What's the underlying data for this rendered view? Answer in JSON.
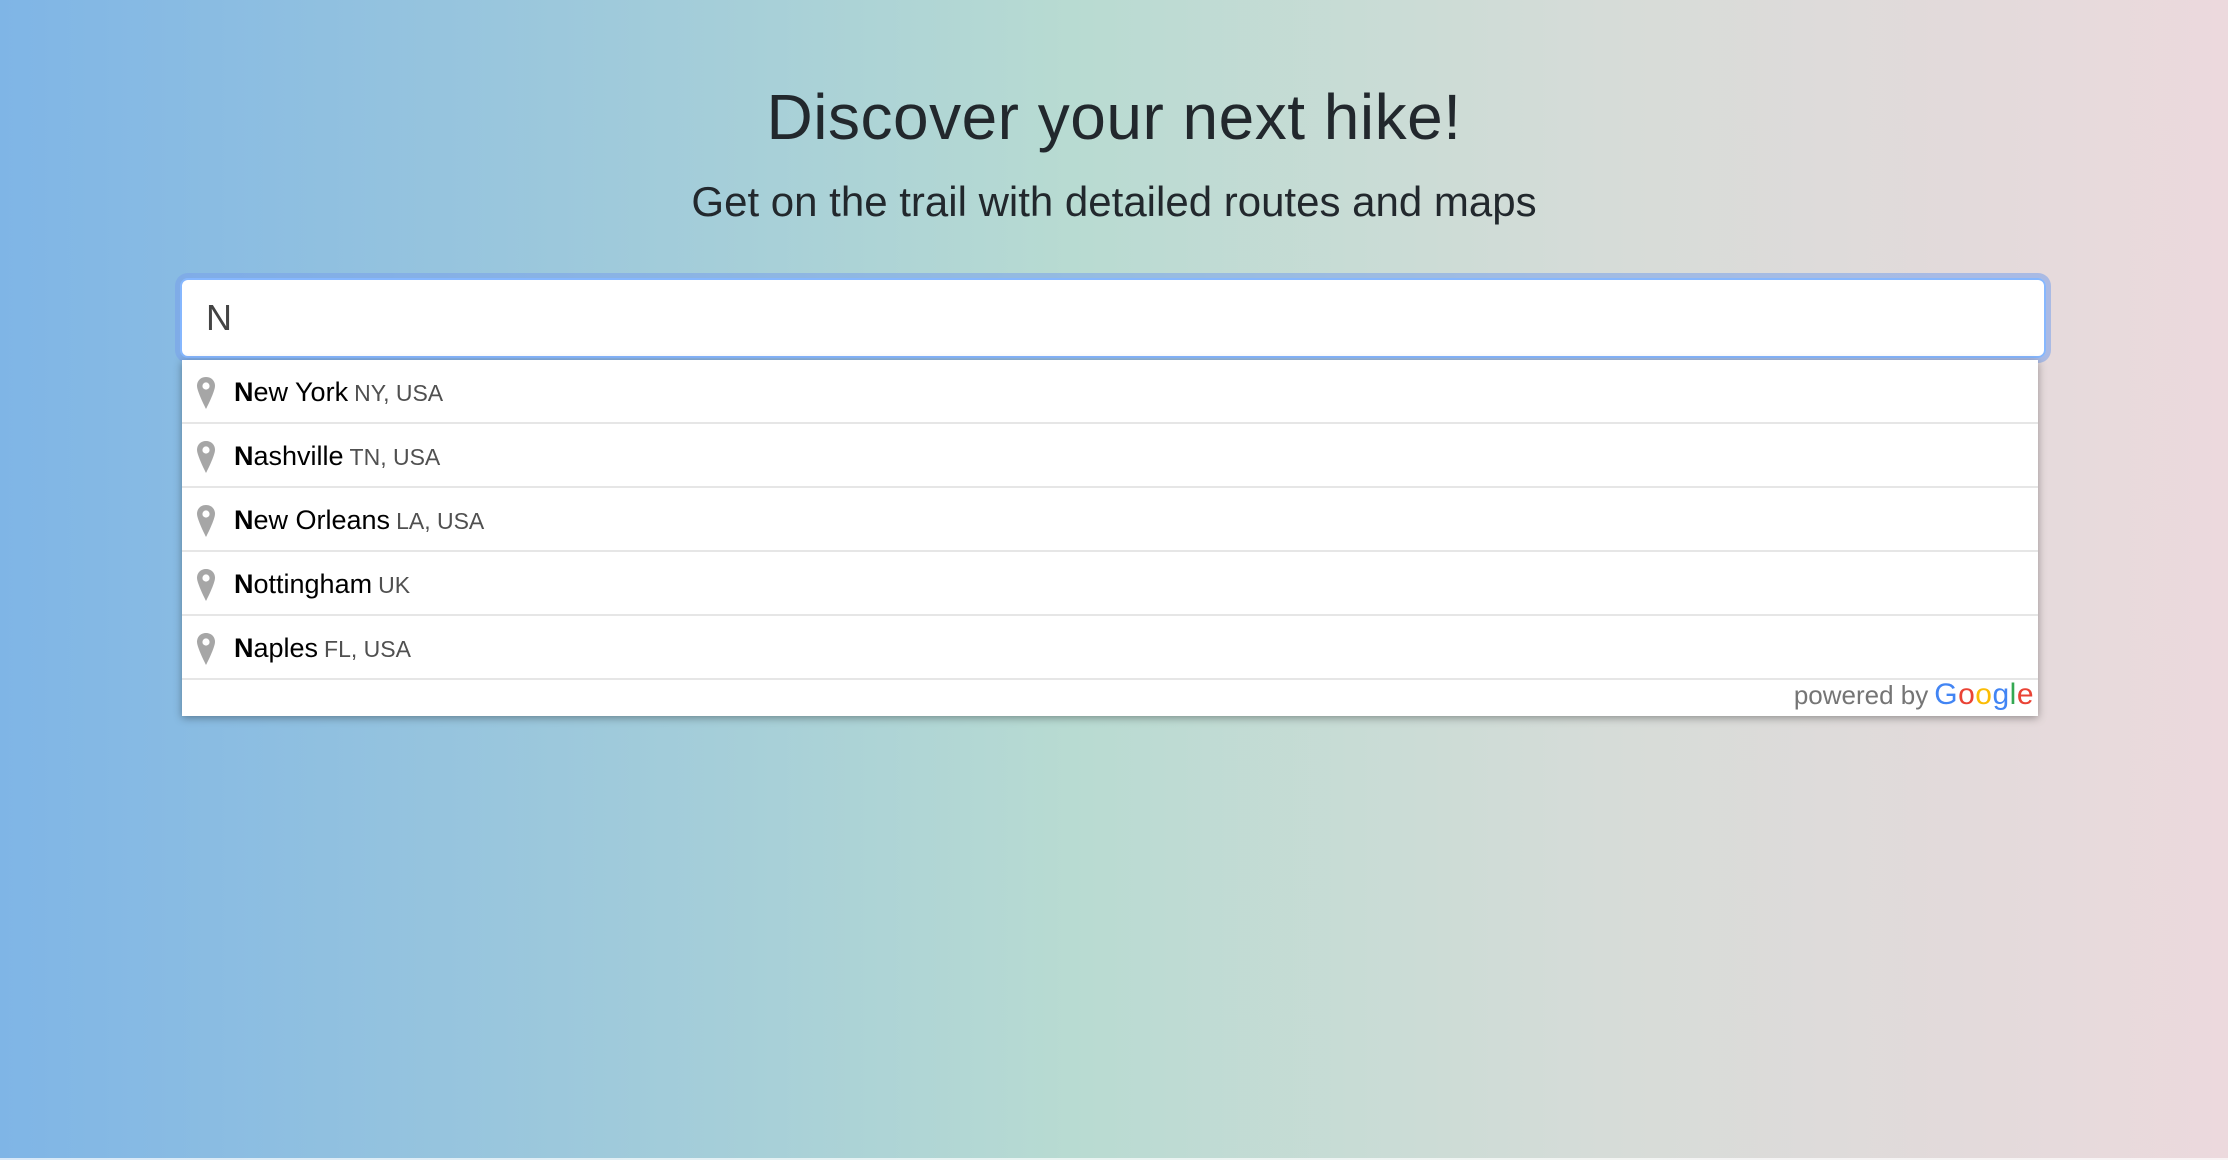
{
  "hero": {
    "title": "Discover your next hike!",
    "subtitle": "Get on the trail with detailed routes and maps"
  },
  "search": {
    "value": "N"
  },
  "suggestions": [
    {
      "match": "N",
      "rest": "ew York",
      "secondary": "NY, USA"
    },
    {
      "match": "N",
      "rest": "ashville",
      "secondary": "TN, USA"
    },
    {
      "match": "N",
      "rest": "ew Orleans",
      "secondary": "LA, USA"
    },
    {
      "match": "N",
      "rest": "ottingham",
      "secondary": "UK"
    },
    {
      "match": "N",
      "rest": "aples",
      "secondary": "FL, USA"
    }
  ],
  "attribution": {
    "prefix": "powered by",
    "brand_letters": [
      "G",
      "o",
      "o",
      "g",
      "l",
      "e"
    ]
  },
  "icons": {
    "suggestion_icon": "map-pin-icon"
  },
  "colors": {
    "focus_ring": "#86b7fe",
    "pin": "#a6a6a6"
  }
}
